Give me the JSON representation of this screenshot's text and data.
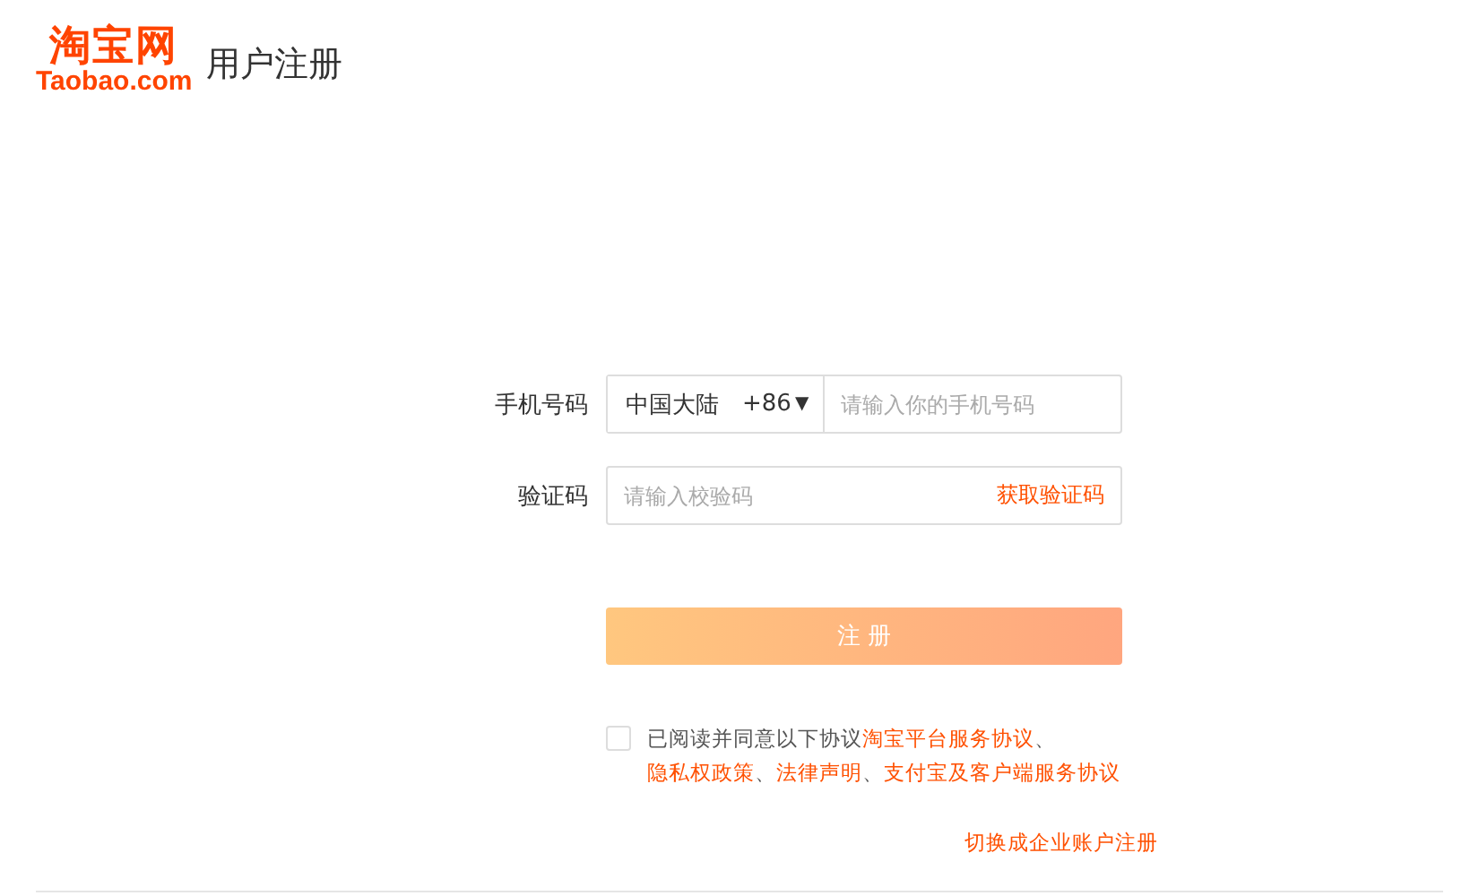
{
  "header": {
    "logo_cn": "淘宝网",
    "logo_en": "Taobao.com",
    "title": "用户注册"
  },
  "form": {
    "phone": {
      "label": "手机号码",
      "region": "中国大陆",
      "code": "+86",
      "caret": "▼",
      "placeholder": "请输入你的手机号码"
    },
    "captcha": {
      "label": "验证码",
      "placeholder": "请输入校验码",
      "action": "获取验证码"
    },
    "submit": {
      "label": "注 册",
      "disabled": true
    },
    "agreement": {
      "checked": false,
      "parts": [
        {
          "kind": "text",
          "text": "已阅读并同意以下协议"
        },
        {
          "kind": "link",
          "text": "淘宝平台服务协议"
        },
        {
          "kind": "sep",
          "text": "、"
        },
        {
          "kind": "link",
          "text": "隐私权政策"
        },
        {
          "kind": "sep",
          "text": "、"
        },
        {
          "kind": "link",
          "text": "法律声明"
        },
        {
          "kind": "sep",
          "text": "、"
        },
        {
          "kind": "link",
          "text": "支付宝及客户端服务协议"
        }
      ]
    },
    "switch_link": "切换成企业账户注册"
  }
}
